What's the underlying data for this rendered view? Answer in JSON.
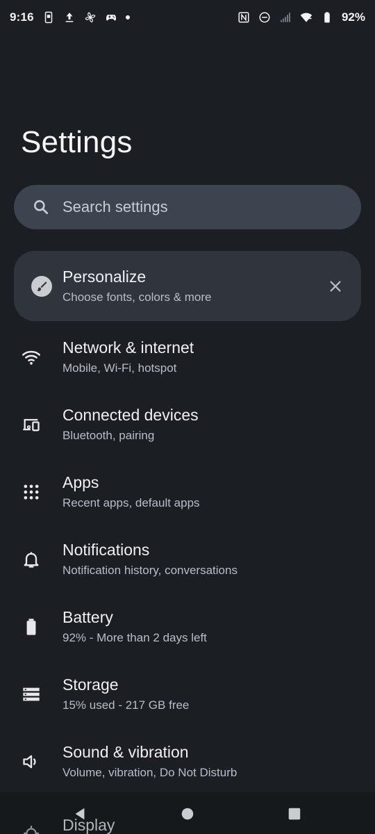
{
  "status_bar": {
    "time": "9:16",
    "battery_percent": "92%",
    "icons_left": [
      "phone-icon",
      "upload-icon",
      "fan-icon",
      "gamepad-icon",
      "dot-icon"
    ],
    "icons_right": [
      "nfc-icon",
      "dnd-icon",
      "signal-icon",
      "wifi-icon",
      "battery-icon"
    ]
  },
  "header": {
    "title": "Settings"
  },
  "search": {
    "placeholder": "Search settings",
    "icon": "search-icon"
  },
  "personalize": {
    "title": "Personalize",
    "subtitle": "Choose fonts, colors & more",
    "icon": "brush-icon",
    "close_icon": "close-icon"
  },
  "items": [
    {
      "title": "Network & internet",
      "subtitle": "Mobile, Wi-Fi, hotspot",
      "icon": "wifi-icon"
    },
    {
      "title": "Connected devices",
      "subtitle": "Bluetooth, pairing",
      "icon": "devices-icon"
    },
    {
      "title": "Apps",
      "subtitle": "Recent apps, default apps",
      "icon": "apps-grid-icon"
    },
    {
      "title": "Notifications",
      "subtitle": "Notification history, conversations",
      "icon": "bell-icon"
    },
    {
      "title": "Battery",
      "subtitle": "92% - More than 2 days left",
      "icon": "battery-icon"
    },
    {
      "title": "Storage",
      "subtitle": "15% used - 217 GB free",
      "icon": "storage-icon"
    },
    {
      "title": "Sound & vibration",
      "subtitle": "Volume, vibration, Do Not Disturb",
      "icon": "volume-icon"
    }
  ],
  "partial_item": {
    "title": "Display",
    "icon": "display-icon"
  },
  "nav": {
    "back_icon": "back-icon",
    "home_icon": "home-icon",
    "recents_icon": "recents-icon"
  },
  "colors": {
    "background": "#1b1e22",
    "search_bg": "#3d4450",
    "card_bg": "#30353c",
    "text_primary": "#eef0f3",
    "text_secondary": "#b9bec6"
  }
}
